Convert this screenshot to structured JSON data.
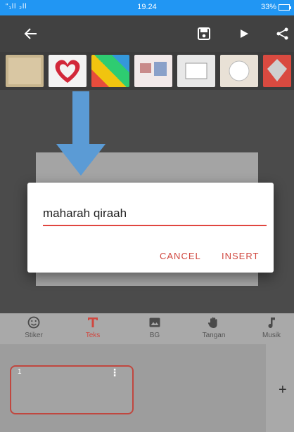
{
  "status_bar": {
    "signal": "\"₁ll ₂ll",
    "time": "19.24",
    "battery": "33%"
  },
  "app_bar": {
    "back_icon": "arrow-left-icon",
    "save_icon": "save-icon",
    "play_icon": "play-icon",
    "share_icon": "share-icon"
  },
  "dialog": {
    "input_value": "maharah qiraah",
    "cancel_label": "CANCEL",
    "insert_label": "INSERT"
  },
  "toolbar": {
    "items": [
      {
        "label": "Stiker",
        "icon": "smiley-icon"
      },
      {
        "label": "Teks",
        "icon": "text-icon"
      },
      {
        "label": "BG",
        "icon": "image-icon"
      },
      {
        "label": "Tangan",
        "icon": "hand-icon"
      },
      {
        "label": "Musik",
        "icon": "music-note-icon"
      }
    ]
  },
  "slides": {
    "first_slide_number": "1",
    "add_label": "+"
  },
  "colors": {
    "status_bar": "#2196f3",
    "accent": "#d0473f",
    "arrow": "#5b9bd5"
  }
}
